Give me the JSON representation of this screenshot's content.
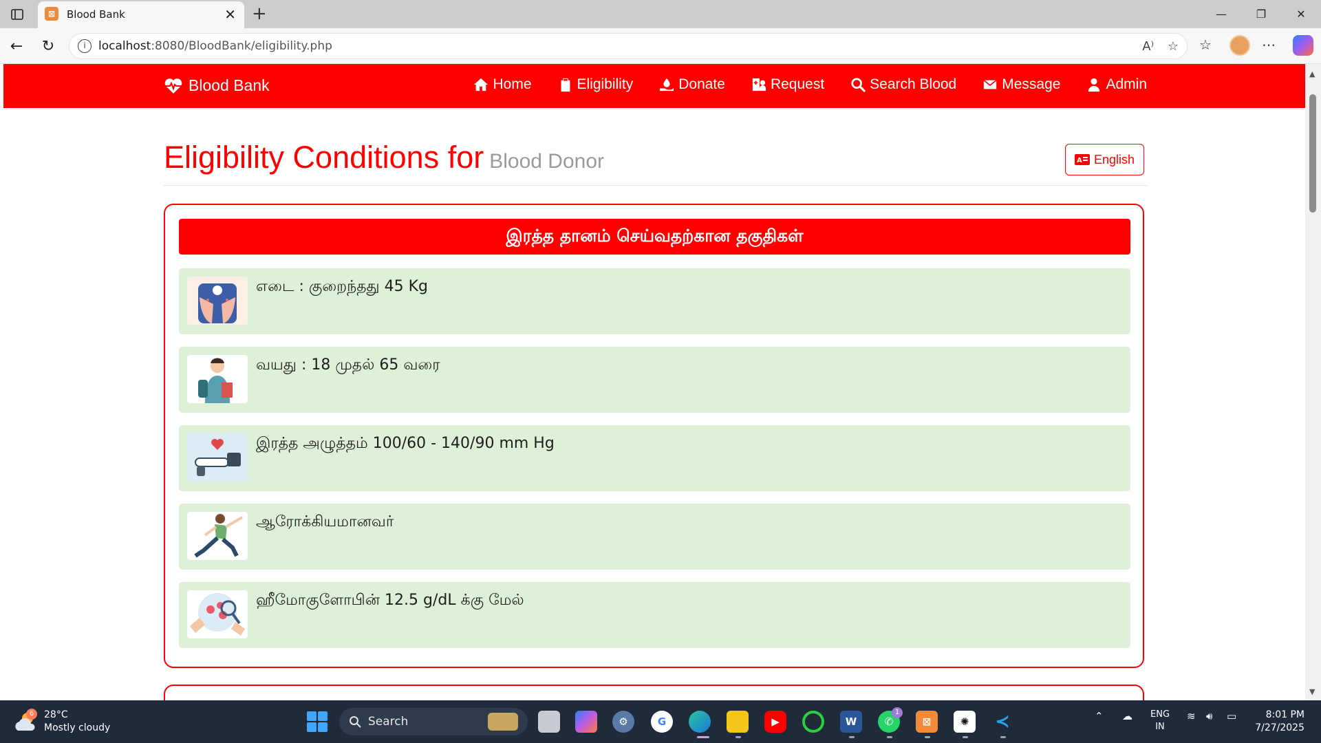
{
  "browser": {
    "tab_title": "Blood Bank",
    "url_host": "localhost",
    "url_rest": ":8080/BloodBank/eligibility.php"
  },
  "navbar": {
    "brand": "Blood Bank",
    "links": [
      "Home",
      "Eligibility",
      "Donate",
      "Request",
      "Search Blood",
      "Message",
      "Admin"
    ]
  },
  "page": {
    "title_main": "Eligibility Conditions for",
    "title_sub": "Blood Donor",
    "language_button": "English"
  },
  "eligibility_card": {
    "header": "இரத்த தானம் செய்வதற்கான தகுதிகள்",
    "items": [
      {
        "text": "எடை : குறைந்தது 45 Kg",
        "icon": "weighing-scale-icon"
      },
      {
        "text": "வயது : 18 முதல் 65 வரை",
        "icon": "young-person-icon"
      },
      {
        "text": "இரத்த அழுத்தம் 100/60 - 140/90 mm Hg",
        "icon": "blood-pressure-icon"
      },
      {
        "text": "ஆரோக்கியமானவர்",
        "icon": "healthy-person-icon"
      },
      {
        "text": "ஹீமோகுளோபின் 12.5 g/dL க்கு மேல்",
        "icon": "hemoglobin-test-icon"
      }
    ]
  },
  "taskbar": {
    "weather_badge": "6",
    "temperature": "28°C",
    "weather": "Mostly cloudy",
    "search_placeholder": "Search",
    "whatsapp_badge": "1",
    "lang_line1": "ENG",
    "lang_line2": "IN",
    "time": "8:01 PM",
    "date": "7/27/2025"
  },
  "colors": {
    "brand_red": "#ff0000",
    "item_green": "#dff0d8",
    "taskbar": "#1f2a3a"
  }
}
